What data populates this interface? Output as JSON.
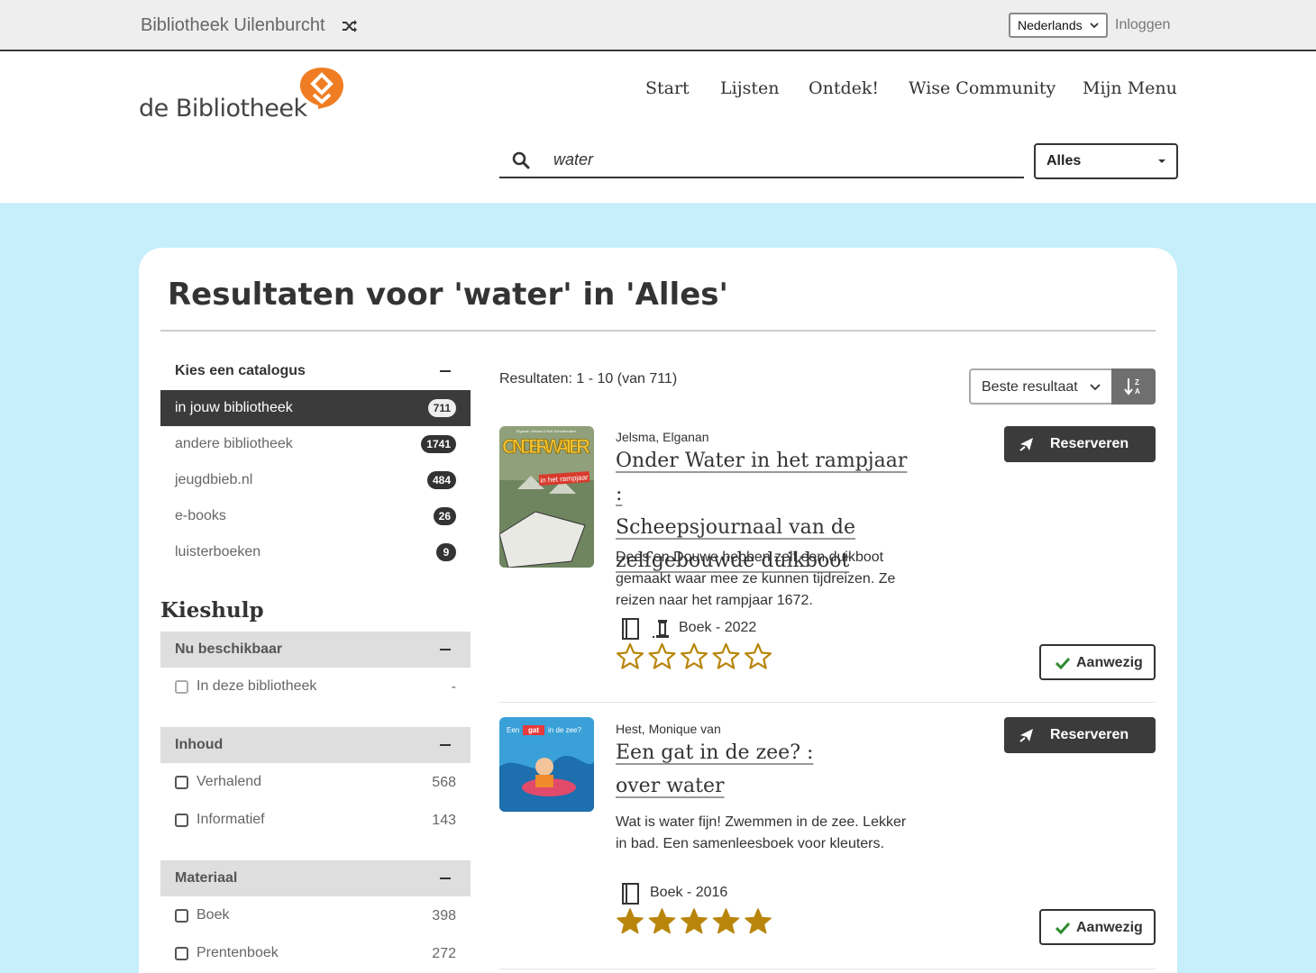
{
  "topbar": {
    "library_name": "Bibliotheek Uilenburcht",
    "language": "Nederlands",
    "login": "Inloggen"
  },
  "header": {
    "logo_text": "de Bibliotheek",
    "nav": [
      "Start",
      "Lijsten",
      "Ontdek!",
      "Wise Community",
      "Mijn Menu"
    ],
    "search_value": "water",
    "search_scope": "Alles"
  },
  "page": {
    "title": "Resultaten voor 'water' in 'Alles'"
  },
  "catalogue": {
    "heading": "Kies een catalogus",
    "items": [
      {
        "label": "in jouw bibliotheek",
        "count": "711"
      },
      {
        "label": "andere bibliotheek",
        "count": "1741"
      },
      {
        "label": "jeugdbieb.nl",
        "count": "484"
      },
      {
        "label": "e-books",
        "count": "26"
      },
      {
        "label": "luisterboeken",
        "count": "9"
      }
    ]
  },
  "kieshulp": {
    "heading": "Kieshulp",
    "groups": [
      {
        "title": "Nu beschikbaar",
        "options": [
          {
            "label": "In deze bibliotheek",
            "count": "-"
          }
        ]
      },
      {
        "title": "Inhoud",
        "options": [
          {
            "label": "Verhalend",
            "count": "568"
          },
          {
            "label": "Informatief",
            "count": "143"
          }
        ]
      },
      {
        "title": "Materiaal",
        "options": [
          {
            "label": "Boek",
            "count": "398"
          },
          {
            "label": "Prentenboek",
            "count": "272"
          }
        ]
      }
    ]
  },
  "results": {
    "count_text": "Resultaten: 1 - 10 (van 711)",
    "sort_label": "Beste resultaat",
    "items": [
      {
        "author": "Jelsma, Elganan",
        "title_lines": [
          "Onder Water in het rampjaar :",
          "Scheepsjournaal van de",
          "zelfgebouwde duikboot"
        ],
        "description": "Dees en Douwe hebben zelf een duikboot gemaakt waar mee ze kunnen tijdreizen. Ze reizen naar het rampjaar 1672.",
        "meta": "Boek - 2022",
        "rating": 0,
        "reserve_label": "Reserveren",
        "availability_label": "Aanwezig",
        "cover_title": "ONDER WATER",
        "cover_sub": "in het rampjaar",
        "cover_authors": "Elganan Jelsma & Rob Schuitemaker"
      },
      {
        "author": "Hest, Monique van",
        "title_lines": [
          "Een gat in de zee? :",
          "over water"
        ],
        "description": "Wat is water fijn! Zwemmen in de zee. Lekker in bad. Een samenleesboek voor kleuters.",
        "meta": "Boek - 2016",
        "rating": 5,
        "reserve_label": "Reserveren",
        "availability_label": "Aanwezig",
        "cover_title_a": "Een",
        "cover_title_b": "gat",
        "cover_title_c": "in de zee?"
      }
    ]
  },
  "colors": {
    "accent_orange": "#f07d23",
    "background_blue": "#c6eefb",
    "star_gold": "#b8860b",
    "dark_button": "#3b3b3b"
  }
}
